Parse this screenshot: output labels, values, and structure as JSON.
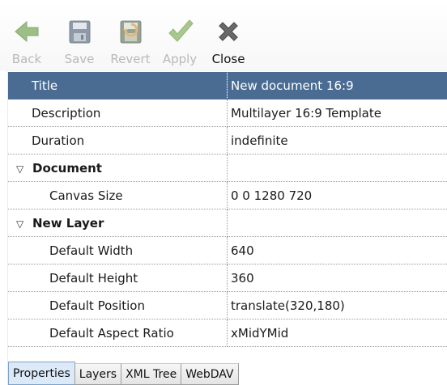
{
  "toolbar": {
    "back": {
      "label": "Back",
      "icon": "back-arrow-icon",
      "enabled": false
    },
    "save": {
      "label": "Save",
      "icon": "floppy-disk-icon",
      "enabled": false
    },
    "revert": {
      "label": "Revert",
      "icon": "floppy-revert-icon",
      "enabled": false
    },
    "apply": {
      "label": "Apply",
      "icon": "checkmark-icon",
      "enabled": false
    },
    "close": {
      "label": "Close",
      "icon": "close-x-icon",
      "enabled": true
    }
  },
  "properties": [
    {
      "name": "Title",
      "value": "New document 16:9",
      "selected": true
    },
    {
      "name": "Description",
      "value": "Multilayer 16:9 Template"
    },
    {
      "name": "Duration",
      "value": "indefinite"
    },
    {
      "group": "Document",
      "expanded": true
    },
    {
      "name": "Canvas Size",
      "value": "0 0 1280 720"
    },
    {
      "group": "New Layer",
      "expanded": true
    },
    {
      "name": "Default Width",
      "value": "640"
    },
    {
      "name": "Default Height",
      "value": "360"
    },
    {
      "name": "Default Position",
      "value": "translate(320,180)"
    },
    {
      "name": "Default Aspect Ratio",
      "value": "xMidYMid"
    }
  ],
  "expander_glyph": "▽",
  "tabs": [
    {
      "label": "Properties",
      "active": true
    },
    {
      "label": "Layers"
    },
    {
      "label": "XML Tree"
    },
    {
      "label": "WebDAV"
    }
  ],
  "colors": {
    "selection": "#4a6c93",
    "disabled_text": "#b9b9b9",
    "active_tab": "#dbe9f8"
  }
}
